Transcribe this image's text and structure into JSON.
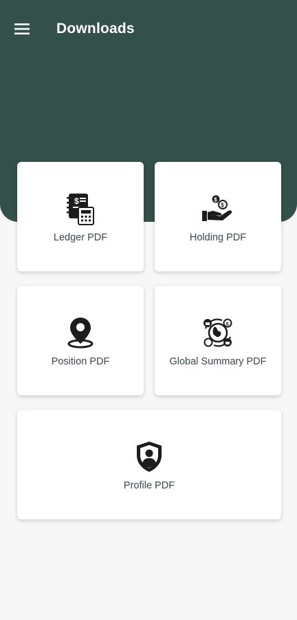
{
  "app_bar": {
    "title": "Downloads",
    "menu_icon": "hamburger-menu-icon",
    "background": "#34504a"
  },
  "cards": [
    {
      "label": "Ledger PDF",
      "icon": "ledger-calculator-icon"
    },
    {
      "label": "Holding PDF",
      "icon": "hand-coins-icon"
    },
    {
      "label": "Position PDF",
      "icon": "location-pin-icon"
    },
    {
      "label": "Global Summary PDF",
      "icon": "global-exchange-icon"
    },
    {
      "label": "Profile PDF",
      "icon": "profile-shield-icon"
    }
  ]
}
